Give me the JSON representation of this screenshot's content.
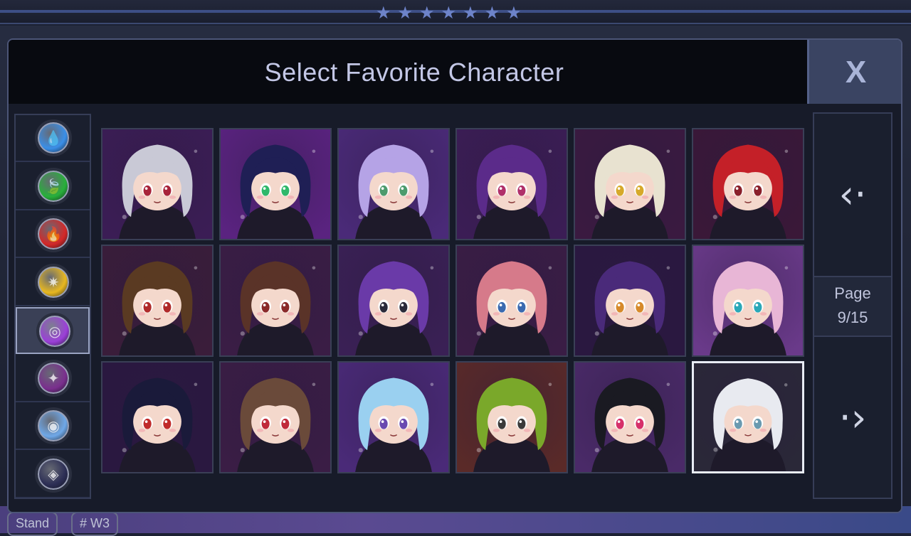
{
  "header": {
    "title": "Select Favorite Character",
    "close_label": "X"
  },
  "background": {
    "star_count": 7,
    "chips": [
      "Stand",
      "# W3"
    ]
  },
  "filters": [
    {
      "name": "water",
      "color": "#3a8fe8",
      "glyph": "💧"
    },
    {
      "name": "nature",
      "color": "#27b03a",
      "glyph": "🍃"
    },
    {
      "name": "fire",
      "color": "#d42828",
      "glyph": "🔥"
    },
    {
      "name": "light",
      "color": "#e8b820",
      "glyph": "✷"
    },
    {
      "name": "dark",
      "color": "#9b3fd8",
      "glyph": "◎",
      "selected": true
    },
    {
      "name": "corrupt",
      "color": "#7a2f8e",
      "glyph": "✦"
    },
    {
      "name": "celestial",
      "color": "#6fa8e8",
      "glyph": "◉"
    },
    {
      "name": "void",
      "color": "#2c2e55",
      "glyph": "◈"
    }
  ],
  "characters": [
    {
      "hair": "#c9c9d6",
      "eye": "#a8233a",
      "bg": "#3b1d55"
    },
    {
      "hair": "#1f1f55",
      "eye": "#2fb86a",
      "bg": "#5a2380"
    },
    {
      "hair": "#b5a3e6",
      "eye": "#4d9b6d",
      "bg": "#4a2a78"
    },
    {
      "hair": "#5b2b8a",
      "eye": "#b0306a",
      "bg": "#3b1d55"
    },
    {
      "hair": "#e8e2d0",
      "eye": "#d6a92a",
      "bg": "#3a1a40"
    },
    {
      "hair": "#c42028",
      "eye": "#8a1f2a",
      "bg": "#3a1838"
    },
    {
      "hair": "#5a3a22",
      "eye": "#b02a2a",
      "bg": "#3a1d3a"
    },
    {
      "hair": "#5a3328",
      "eye": "#8a2a2a",
      "bg": "#3a1d45"
    },
    {
      "hair": "#6a3aa8",
      "eye": "#2a2a3a",
      "bg": "#3a2055"
    },
    {
      "hair": "#d67a8a",
      "eye": "#3a6ab0",
      "bg": "#3a1d45"
    },
    {
      "hair": "#4a2a7a",
      "eye": "#d68a2a",
      "bg": "#2a1840"
    },
    {
      "hair": "#e8b6d6",
      "eye": "#2aa8b8",
      "bg": "#6a3a8a"
    },
    {
      "hair": "#1a1a3a",
      "eye": "#c02a2a",
      "bg": "#2a1840"
    },
    {
      "hair": "#6a4a3a",
      "eye": "#c02a3a",
      "bg": "#3a1d45"
    },
    {
      "hair": "#9ad0f0",
      "eye": "#6a4ab0",
      "bg": "#4a2a78"
    },
    {
      "hair": "#7aa82a",
      "eye": "#3a3a3a",
      "bg": "#5a2a28"
    },
    {
      "hair": "#1a1a22",
      "eye": "#d6306a",
      "bg": "#4a2a68"
    },
    {
      "hair": "#e8eaf0",
      "eye": "#6a9ab0",
      "bg": "#2a2838",
      "selected": true
    }
  ],
  "pagination": {
    "label": "Page",
    "value": "9/15",
    "prev_glyph": "‹·",
    "next_glyph": "·›"
  }
}
